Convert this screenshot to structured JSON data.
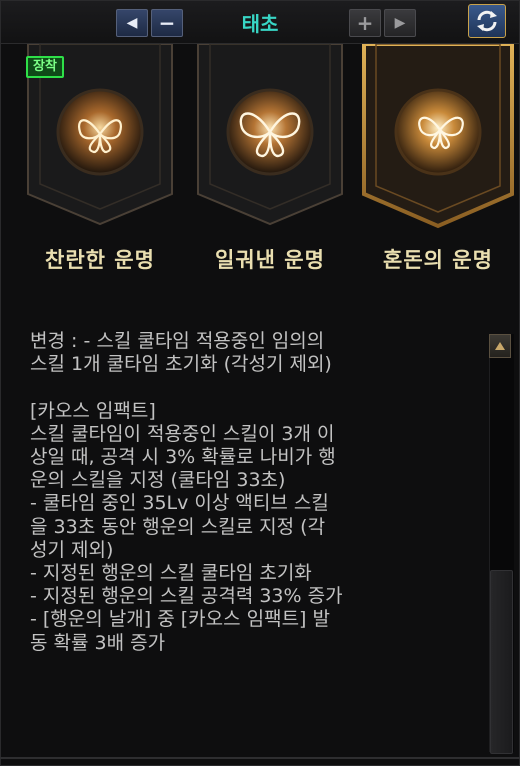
{
  "header": {
    "title": "태초",
    "prev_icon": "chevron-left-icon",
    "minus_icon": "minus-icon",
    "plus_icon": "plus-icon",
    "next_icon": "chevron-right-icon",
    "refresh_icon": "refresh-icon"
  },
  "cards": [
    {
      "label": "찬란한 운명",
      "badge": "장착",
      "selected": false
    },
    {
      "label": "일궈낸 운명",
      "selected": false
    },
    {
      "label": "혼돈의 운명",
      "selected": true
    }
  ],
  "description": {
    "lines": [
      "변경 : - 스킬 쿨타임 적용중인 임의의",
      "스킬 1개 쿨타임 초기화 (각성기 제외)",
      "",
      "[카오스 임팩트]",
      "스킬 쿨타임이 적용중인 스킬이 3개 이",
      "상일 때, 공격 시 3% 확률로 나비가 행",
      "운의 스킬을 지정 (쿨타임 33초)",
      "- 쿨타임 중인 35Lv 이상 액티브 스킬",
      "을 33초 동안 행운의 스킬로 지정 (각",
      "성기 제외)",
      "- 지정된 행운의 스킬 쿨타임 초기화",
      "- 지정된 행운의 스킬 공격력 33% 증가",
      "- [행운의 날개] 중 [카오스 임팩트] 발",
      "동 확률 3배 증가"
    ]
  },
  "colors": {
    "title": "#38d6c5",
    "card_label": "#eadfb0",
    "description_text": "#c2c2c2",
    "equip_badge": "#2ee048",
    "gold_frame": "#c9a24a"
  }
}
